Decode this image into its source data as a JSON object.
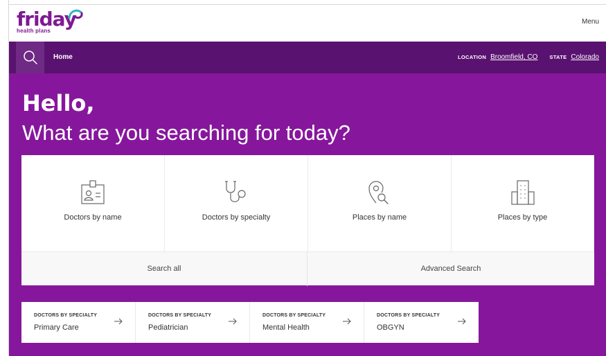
{
  "brand": {
    "name": "friday",
    "tagline": "health plans",
    "color": "#7e1a93"
  },
  "header": {
    "menu_label": "Menu"
  },
  "nav": {
    "home_label": "Home",
    "location_key": "LOCATION",
    "location_value": "Broomfield, CO",
    "state_key": "STATE",
    "state_value": "Colorado"
  },
  "hero": {
    "greeting": "Hello,",
    "prompt": "What are you searching for today?"
  },
  "search_cards": [
    {
      "label": "Doctors by name",
      "icon": "id-badge-icon"
    },
    {
      "label": "Doctors by specialty",
      "icon": "stethoscope-icon"
    },
    {
      "label": "Places by name",
      "icon": "location-search-icon"
    },
    {
      "label": "Places by type",
      "icon": "building-icon"
    }
  ],
  "search_actions": {
    "search_all": "Search all",
    "advanced": "Advanced Search"
  },
  "quick_links": [
    {
      "kicker": "DOCTORS BY SPECIALTY",
      "label": "Primary Care"
    },
    {
      "kicker": "DOCTORS BY SPECIALTY",
      "label": "Pediatrician"
    },
    {
      "kicker": "DOCTORS BY SPECIALTY",
      "label": "Mental Health"
    },
    {
      "kicker": "DOCTORS BY SPECIALTY",
      "label": "OBGYN"
    }
  ],
  "colors": {
    "nav_bg": "#5a1270",
    "hero_bg": "#86179c",
    "accent": "#7e1a93"
  }
}
